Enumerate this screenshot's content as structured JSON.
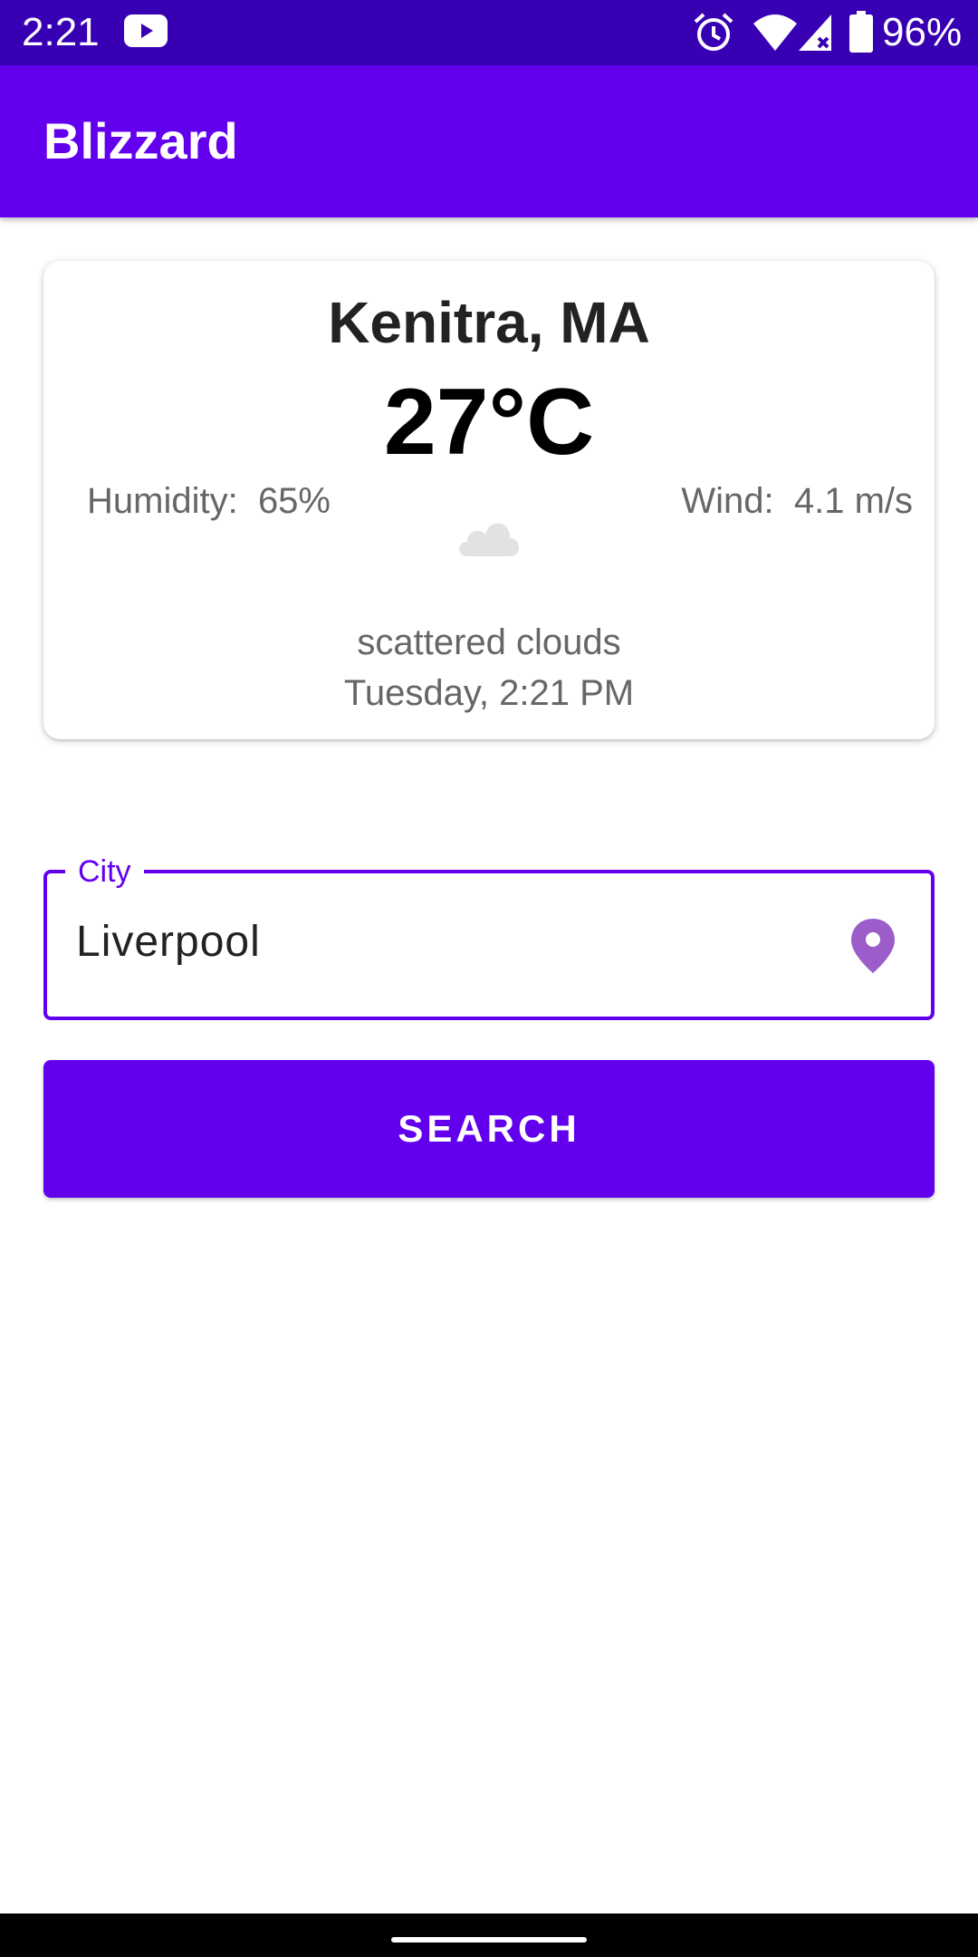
{
  "status_bar": {
    "time": "2:21",
    "battery": "96%",
    "icons": [
      "youtube-icon",
      "alarm-icon",
      "wifi-icon",
      "signal-icon",
      "battery-icon"
    ]
  },
  "app_bar": {
    "title": "Blizzard"
  },
  "weather": {
    "city": "Kenitra, MA",
    "temperature": "27°C",
    "humidity_label": "Humidity:",
    "humidity_value": "65%",
    "wind_label": "Wind:",
    "wind_value": "4.1 m/s",
    "icon": "cloud-icon",
    "description": "scattered clouds",
    "datetime": "Tuesday, 2:21 PM"
  },
  "search": {
    "field_label": "City",
    "field_value": "Liverpool",
    "field_icon": "location-pin-icon",
    "button_label": "SEARCH"
  },
  "colors": {
    "status_bar": "#3700b3",
    "primary": "#6200ee",
    "location_icon": "#9c5cc9"
  }
}
